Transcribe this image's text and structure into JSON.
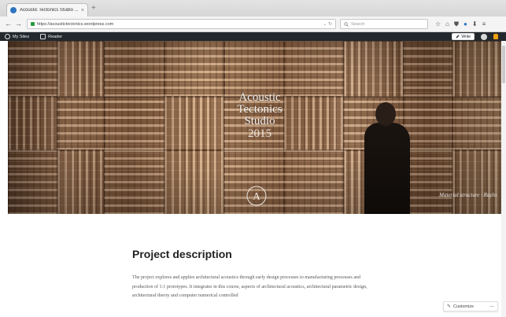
{
  "browser": {
    "tab_title": "Acoustic Tectonics Studio ...",
    "tab_close": "×",
    "new_tab": "+",
    "back": "←",
    "forward": "→",
    "url": "https://acoustictectonics.wordpress.com",
    "url_actions": "⌄ ↻",
    "search_placeholder": "Search",
    "tools": [
      "☆",
      "⌂",
      "⛊",
      "●",
      "⬇",
      "≡"
    ]
  },
  "wp_admin_bar": {
    "my_sites": "My Sites",
    "reader": "Reader",
    "write": "Write"
  },
  "hero": {
    "title_lines": [
      "Acoustic",
      "Tectonics",
      "Studio"
    ],
    "year": "2015",
    "logo_letter": "A",
    "credit": "Material structure · Raylo"
  },
  "content": {
    "title": "Project description",
    "paragraph": "The project explores and applies architectural acoustics through early design processes to manufacturing processes and production of 1:1 prototypes. It integrates in this course, aspects of architectural acoustics, architectural parametric design, architectural theory and computer numerical controlled"
  },
  "customize": {
    "label": "Customize",
    "icon": "✎",
    "dash": "—"
  }
}
